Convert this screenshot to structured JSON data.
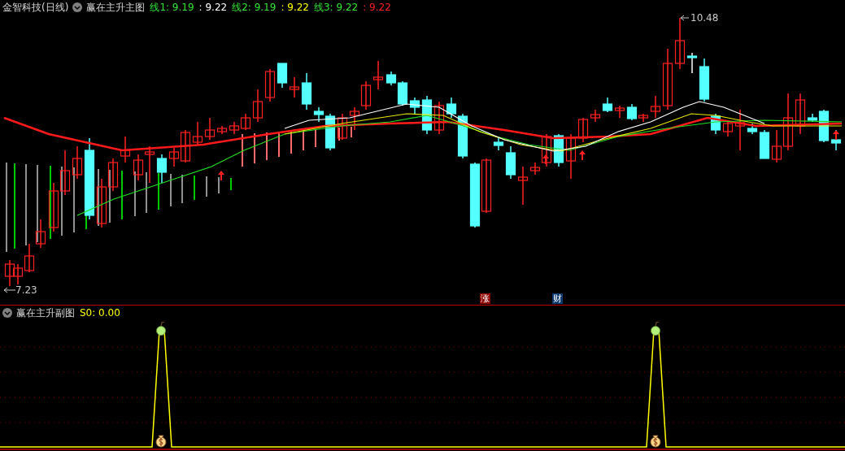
{
  "main_panel": {
    "title": "金智科技(日线)",
    "indicator": "赢在主升主图",
    "readings": [
      {
        "text": "线1: 9.19",
        "color": "#33e633"
      },
      {
        "text": ": 9.22",
        "color": "#ffffff"
      },
      {
        "text": "线2: 9.19",
        "color": "#33e633"
      },
      {
        "text": ": 9.22",
        "color": "#ffff00"
      },
      {
        "text": "线3: 9.22",
        "color": "#33e633"
      },
      {
        "text": ": 9.22",
        "color": "#ff2020"
      }
    ],
    "high_label": "10.48",
    "low_label": "7.23",
    "markers": [
      {
        "text": "涨",
        "color": "#8b0000"
      },
      {
        "text": "财",
        "color": "#0d3a6e"
      }
    ]
  },
  "sub_panel": {
    "indicator": "赢在主升副图",
    "reading": "S0: 0.00"
  }
}
